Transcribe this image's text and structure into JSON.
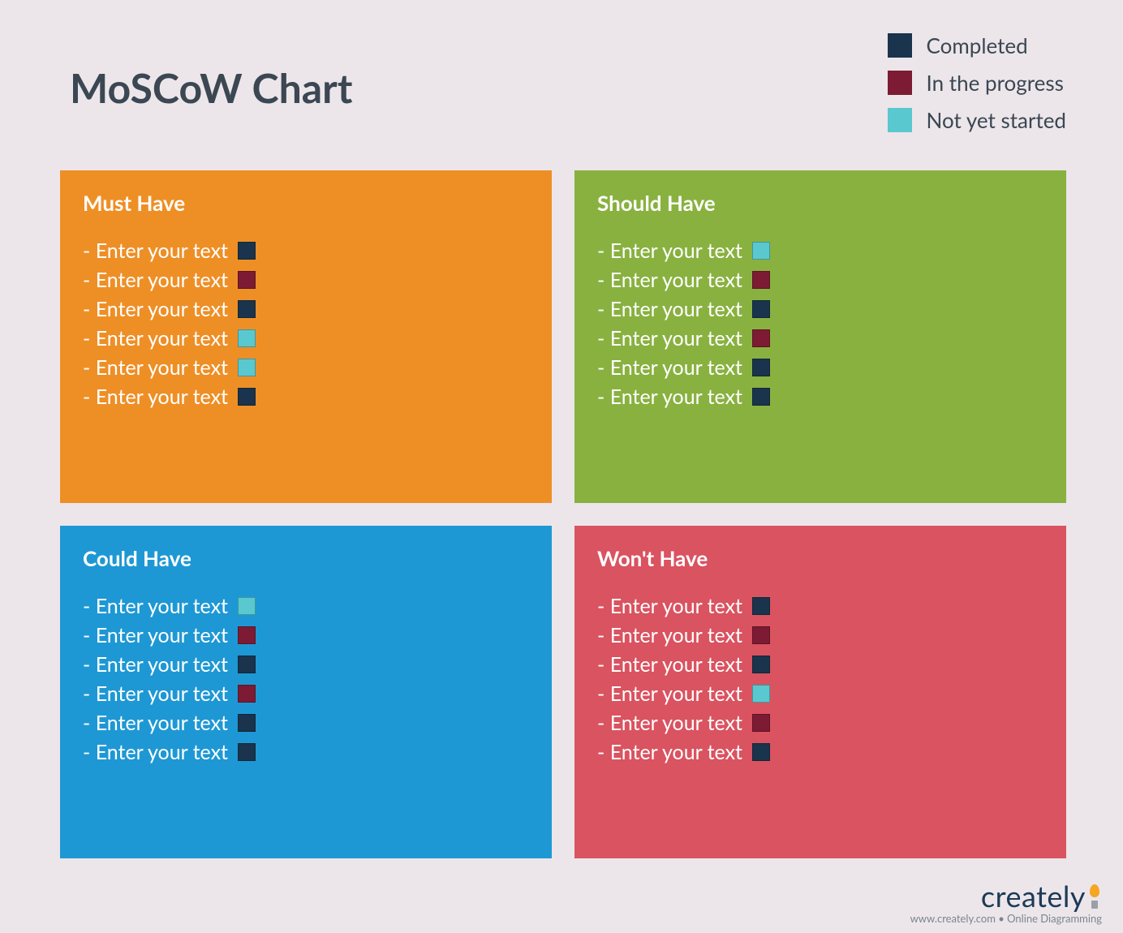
{
  "title": "MoSCoW Chart",
  "status_colors": {
    "completed": "#19344c",
    "in_progress": "#7c1b33",
    "not_started": "#59c8cf"
  },
  "legend": [
    {
      "label": "Completed",
      "status": "completed"
    },
    {
      "label": "In the progress",
      "status": "in_progress"
    },
    {
      "label": "Not yet started",
      "status": "not_started"
    }
  ],
  "quadrant_colors": {
    "must": "#ee8f26",
    "should": "#89b140",
    "could": "#1e98d4",
    "wont": "#da5360"
  },
  "quadrants": {
    "must": {
      "title": "Must Have",
      "items": [
        {
          "text": "- Enter your text",
          "status": "completed"
        },
        {
          "text": "- Enter your text",
          "status": "in_progress"
        },
        {
          "text": "- Enter your text",
          "status": "completed"
        },
        {
          "text": "- Enter your text",
          "status": "not_started"
        },
        {
          "text": "- Enter your text",
          "status": "not_started"
        },
        {
          "text": "- Enter your text",
          "status": "completed"
        }
      ]
    },
    "should": {
      "title": "Should Have",
      "items": [
        {
          "text": "- Enter your text",
          "status": "not_started"
        },
        {
          "text": "- Enter your text",
          "status": "in_progress"
        },
        {
          "text": "- Enter your text",
          "status": "completed"
        },
        {
          "text": "- Enter your text",
          "status": "in_progress"
        },
        {
          "text": "- Enter your text",
          "status": "completed"
        },
        {
          "text": "- Enter your text",
          "status": "completed"
        }
      ]
    },
    "could": {
      "title": "Could Have",
      "items": [
        {
          "text": "- Enter your text",
          "status": "not_started"
        },
        {
          "text": "- Enter your text",
          "status": "in_progress"
        },
        {
          "text": "- Enter your text",
          "status": "completed"
        },
        {
          "text": "- Enter your text",
          "status": "in_progress"
        },
        {
          "text": "- Enter your text",
          "status": "completed"
        },
        {
          "text": "- Enter your text",
          "status": "completed"
        }
      ]
    },
    "wont": {
      "title": "Won't Have",
      "items": [
        {
          "text": "- Enter your text",
          "status": "completed"
        },
        {
          "text": "- Enter your text",
          "status": "in_progress"
        },
        {
          "text": "- Enter your text",
          "status": "completed"
        },
        {
          "text": "- Enter your text",
          "status": "not_started"
        },
        {
          "text": "- Enter your text",
          "status": "in_progress"
        },
        {
          "text": "- Enter your text",
          "status": "completed"
        }
      ]
    }
  },
  "footer": {
    "brand": "creately",
    "tagline": "www.creately.com • Online Diagramming"
  }
}
